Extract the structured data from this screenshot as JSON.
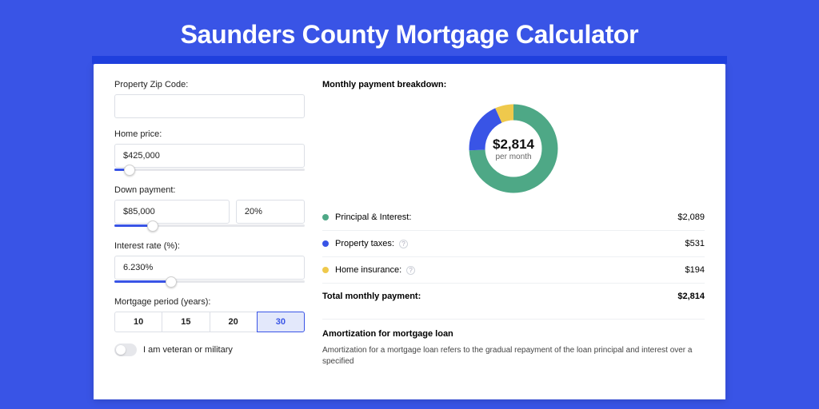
{
  "title": "Saunders County Mortgage Calculator",
  "form": {
    "zip_label": "Property Zip Code:",
    "zip_value": "",
    "home_price_label": "Home price:",
    "home_price_value": "$425,000",
    "home_price_slider_pct": 8,
    "down_label": "Down payment:",
    "down_value": "$85,000",
    "down_pct_value": "20%",
    "down_slider_pct": 20,
    "rate_label": "Interest rate (%):",
    "rate_value": "6.230%",
    "rate_slider_pct": 30,
    "period_label": "Mortgage period (years):",
    "periods": [
      "10",
      "15",
      "20",
      "30"
    ],
    "period_active": "30",
    "veteran_label": "I am veteran or military"
  },
  "breakdown": {
    "heading": "Monthly payment breakdown:",
    "amount": "$2,814",
    "subtext": "per month",
    "items": [
      {
        "label": "Principal & Interest:",
        "value": "$2,089",
        "color": "#4ea886",
        "info": false
      },
      {
        "label": "Property taxes:",
        "value": "$531",
        "color": "#3954e6",
        "info": true
      },
      {
        "label": "Home insurance:",
        "value": "$194",
        "color": "#efc94c",
        "info": true
      }
    ],
    "total_label": "Total monthly payment:",
    "total_value": "$2,814"
  },
  "amort": {
    "heading": "Amortization for mortgage loan",
    "body": "Amortization for a mortgage loan refers to the gradual repayment of the loan principal and interest over a specified"
  },
  "chart_data": {
    "type": "pie",
    "title": "Monthly payment breakdown",
    "series": [
      {
        "name": "Principal & Interest",
        "value": 2089,
        "color": "#4ea886"
      },
      {
        "name": "Property taxes",
        "value": 531,
        "color": "#3954e6"
      },
      {
        "name": "Home insurance",
        "value": 194,
        "color": "#efc94c"
      }
    ],
    "total": 2814,
    "center_label": "$2,814 per month"
  }
}
